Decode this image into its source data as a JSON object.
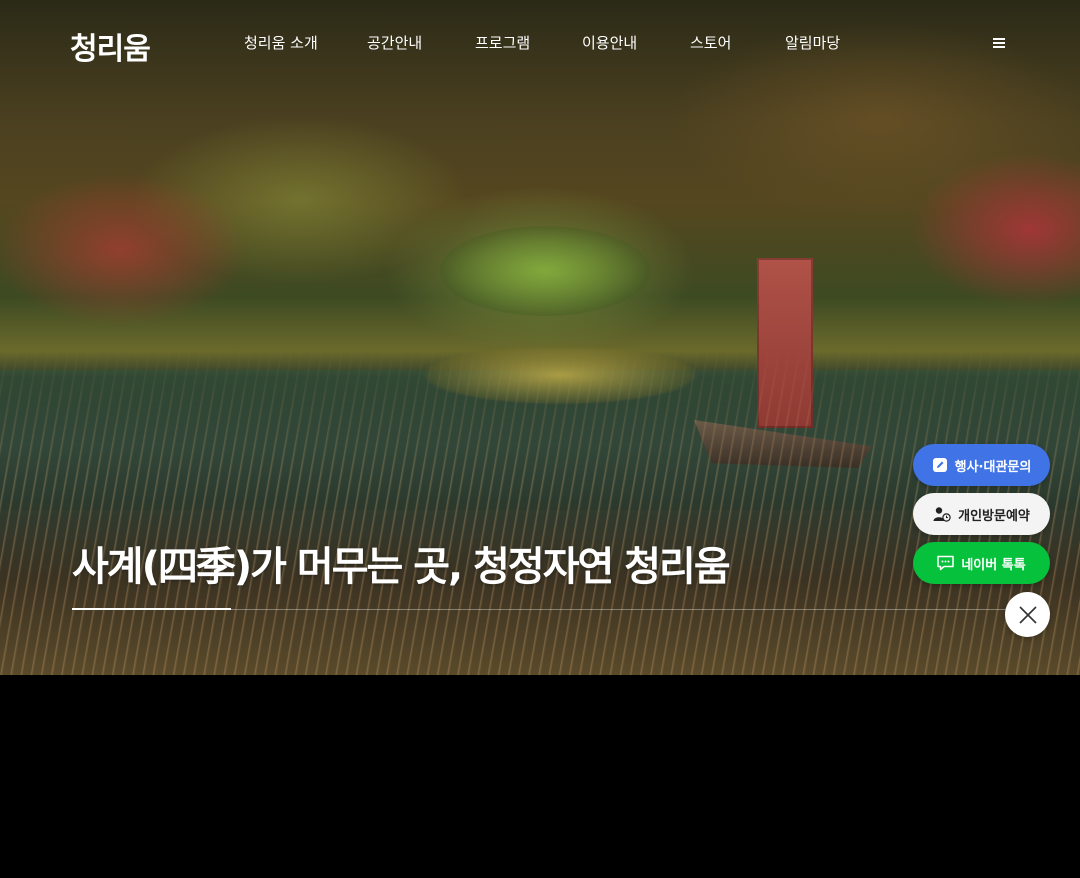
{
  "header": {
    "logo_text": "청리움",
    "nav": [
      {
        "label": "청리움 소개"
      },
      {
        "label": "공간안내"
      },
      {
        "label": "프로그램"
      },
      {
        "label": "이용안내"
      },
      {
        "label": "스토어"
      },
      {
        "label": "알림마당"
      }
    ],
    "menu_icon": "hamburger-icon"
  },
  "hero": {
    "headline": "사계(四季)가 머무는 곳, 청정자연 청리움",
    "slide_progress_percent": 17
  },
  "floating_buttons": {
    "event_inquiry": {
      "label": "행사·대관문의",
      "icon": "edit-note-icon",
      "color": "#3f73e6"
    },
    "personal_visit": {
      "label": "개인방문예약",
      "icon": "user-clock-icon",
      "color": "#f4f4f4"
    },
    "naver_talk": {
      "label": "네이버 톡톡",
      "icon": "chat-bubble-icon",
      "color": "#05c13b"
    },
    "close": {
      "icon": "close-icon"
    }
  }
}
